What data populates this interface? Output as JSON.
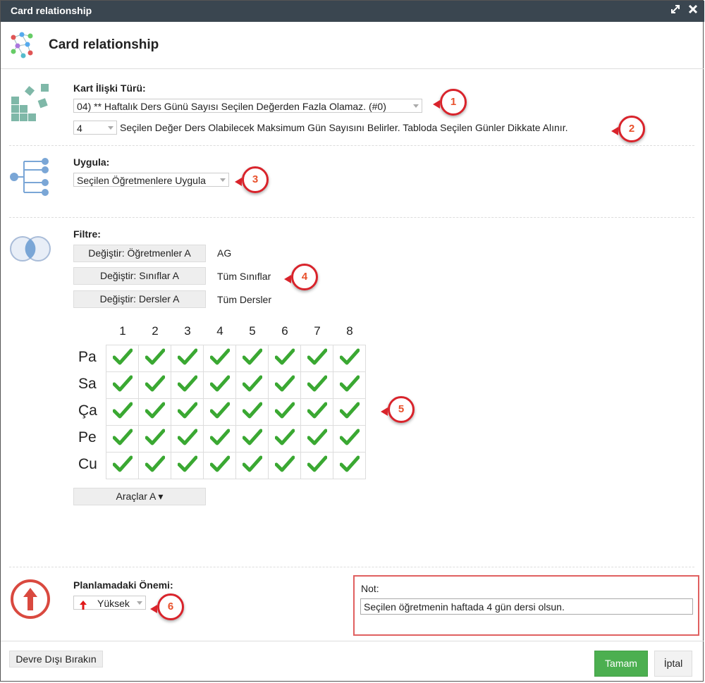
{
  "window": {
    "title": "Card relationship",
    "icons": {
      "maximize": "expand-icon",
      "close": "close-icon"
    }
  },
  "header": {
    "title": "Card relationship",
    "icon": "network-icon"
  },
  "relation": {
    "label": "Kart İlişki Türü:",
    "type_value": "04) ** Haftalık Ders Günü Sayısı Seçilen Değerden Fazla Olamaz. (#0)",
    "count_value": "4",
    "description": "Seçilen Değer Ders Olabilecek Maksimum Gün Sayısını Belirler. Tabloda Seçilen Günler Dikkate Alınır."
  },
  "apply": {
    "label": "Uygula:",
    "value": "Seçilen Öğretmenlere Uygula"
  },
  "filter": {
    "label": "Filtre:",
    "rows": [
      {
        "button": "Değiştir: Öğretmenler A",
        "value": "AG"
      },
      {
        "button": "Değiştir: Sınıflar A",
        "value": "Tüm Sınıflar"
      },
      {
        "button": "Değiştir: Dersler A",
        "value": "Tüm Dersler"
      }
    ]
  },
  "grid": {
    "columns": [
      "1",
      "2",
      "3",
      "4",
      "5",
      "6",
      "7",
      "8"
    ],
    "rows": [
      "Pa",
      "Sa",
      "Ça",
      "Pe",
      "Cu"
    ],
    "all_checked": true,
    "check_color": "#3aa832"
  },
  "tools_button": "Araçlar A ▾",
  "priority": {
    "label": "Planlamadaki Önemi:",
    "value": "Yüksek",
    "icon": "up-arrow-icon",
    "color": "#d9232b"
  },
  "note": {
    "label": "Not:",
    "value": "Seçilen öğretmenin haftada 4 gün dersi olsun."
  },
  "footer": {
    "disable_button": "Devre Dışı Bırakın",
    "ok_button": "Tamam",
    "cancel_button": "İptal"
  },
  "annotations": [
    "1",
    "2",
    "3",
    "4",
    "5",
    "6"
  ],
  "colors": {
    "titlebar": "#3a4650",
    "ok": "#4caf50",
    "badge": "#d9232b"
  }
}
